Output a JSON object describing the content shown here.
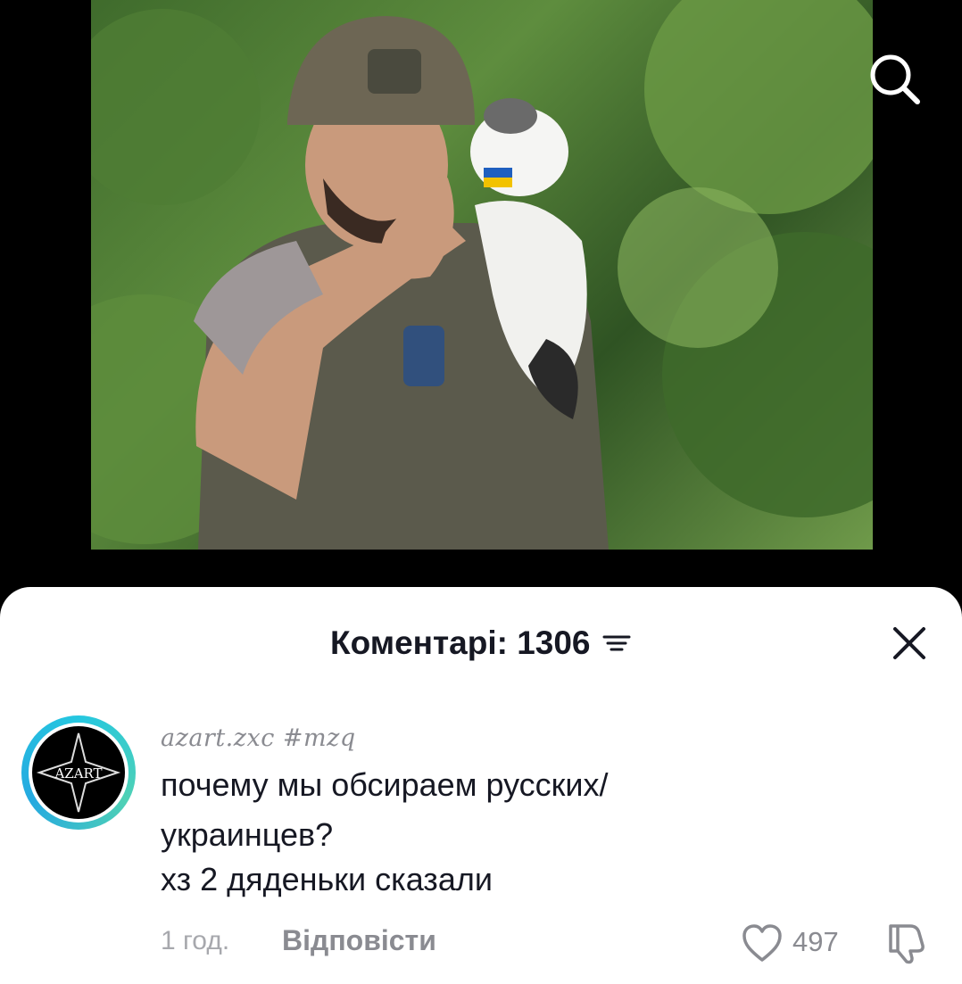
{
  "video": {
    "image_description_icon": "video-frame"
  },
  "comments_sheet": {
    "title": "Коментарі: 1306"
  },
  "comment": {
    "username": "azart.zxc #mzq",
    "avatar_text": "AZART",
    "text_lines": [
      "почему мы обсираем русских/",
      "украинцев?",
      "хз 2 дяденьки сказали"
    ],
    "time": "1 год.",
    "reply_label": "Відповісти",
    "like_count": "497"
  },
  "colors": {
    "sheet_bg": "#ffffff",
    "title": "#161823",
    "secondary": "#8a8b91",
    "avatar_ring": "#25c7e0"
  }
}
